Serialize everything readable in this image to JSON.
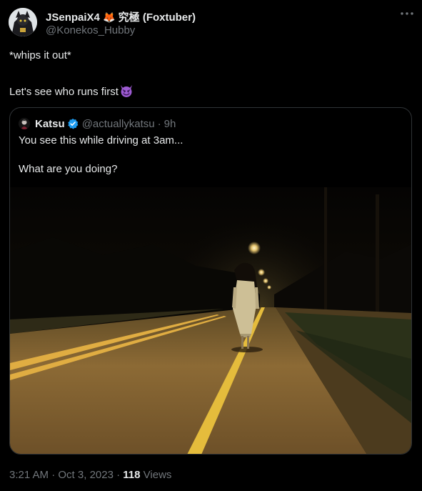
{
  "author": {
    "display_name": "JSenpaiX4",
    "name_emoji": "🦊",
    "name_suffix": "究極 (Foxtuber)",
    "handle": "@Konekos_Hubby",
    "avatar_icon": "avatar-image"
  },
  "menu_icon": "more-horizontal-icon",
  "post": {
    "line1": "*whips it out*",
    "line2": "Let's see who runs first",
    "emoji": "smiling-devil-emoji"
  },
  "quote": {
    "name": "Katsu",
    "handle": "@actuallykatsu",
    "separator": "·",
    "time": "9h",
    "verified_icon": "verified-badge-icon",
    "line1": "You see this while driving at 3am...",
    "line2": "What are you doing?",
    "image": "night-road-ghost-photo"
  },
  "footer": {
    "time": "3:21 AM",
    "separator": "·",
    "date": "Oct 3, 2023",
    "views_count": "118",
    "views_label": "Views"
  },
  "colors": {
    "background": "#000000",
    "text_primary": "#e7e9ea",
    "text_secondary": "#71767b",
    "border": "#2f3336",
    "verified_blue": "#1d9bf0",
    "devil_purple": "#9d5bd2"
  }
}
